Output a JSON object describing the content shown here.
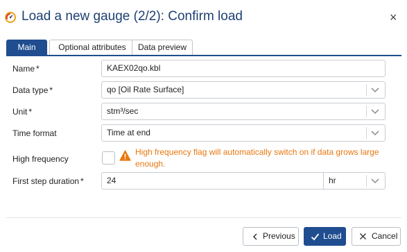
{
  "dialog": {
    "title": "Load a new gauge (2/2): Confirm load",
    "close_symbol": "×",
    "icons": {
      "title": "gauge-icon",
      "close": "close-icon"
    }
  },
  "tabs": [
    {
      "label": "Main",
      "active": true
    },
    {
      "label": "Optional attributes",
      "active": false
    },
    {
      "label": "Data preview",
      "active": false
    }
  ],
  "form": {
    "required_marker": "*",
    "name": {
      "label": "Name",
      "value": "KAEX02qo.kbl"
    },
    "data_type": {
      "label": "Data type",
      "value": "qo [Oil Rate Surface]"
    },
    "unit": {
      "label": "Unit",
      "value": "stm³/sec"
    },
    "time_format": {
      "label": "Time format",
      "value": "Time at end"
    },
    "high_frequency": {
      "label": "High frequency",
      "checked": false,
      "warning": "High frequency flag will automatically switch on if data grows large enough.",
      "warning_icon": "warning-triangle-icon"
    },
    "first_step": {
      "label": "First step duration",
      "value": "24",
      "unit": "hr"
    }
  },
  "buttons": {
    "previous": {
      "label": "Previous",
      "icon": "chevron-left-icon"
    },
    "load": {
      "label": "Load",
      "icon": "check-icon"
    },
    "cancel": {
      "label": "Cancel",
      "icon": "close-icon"
    }
  },
  "colors": {
    "accent": "#1f4d8f",
    "title": "#1e3f73",
    "warning": "#e8770f"
  }
}
